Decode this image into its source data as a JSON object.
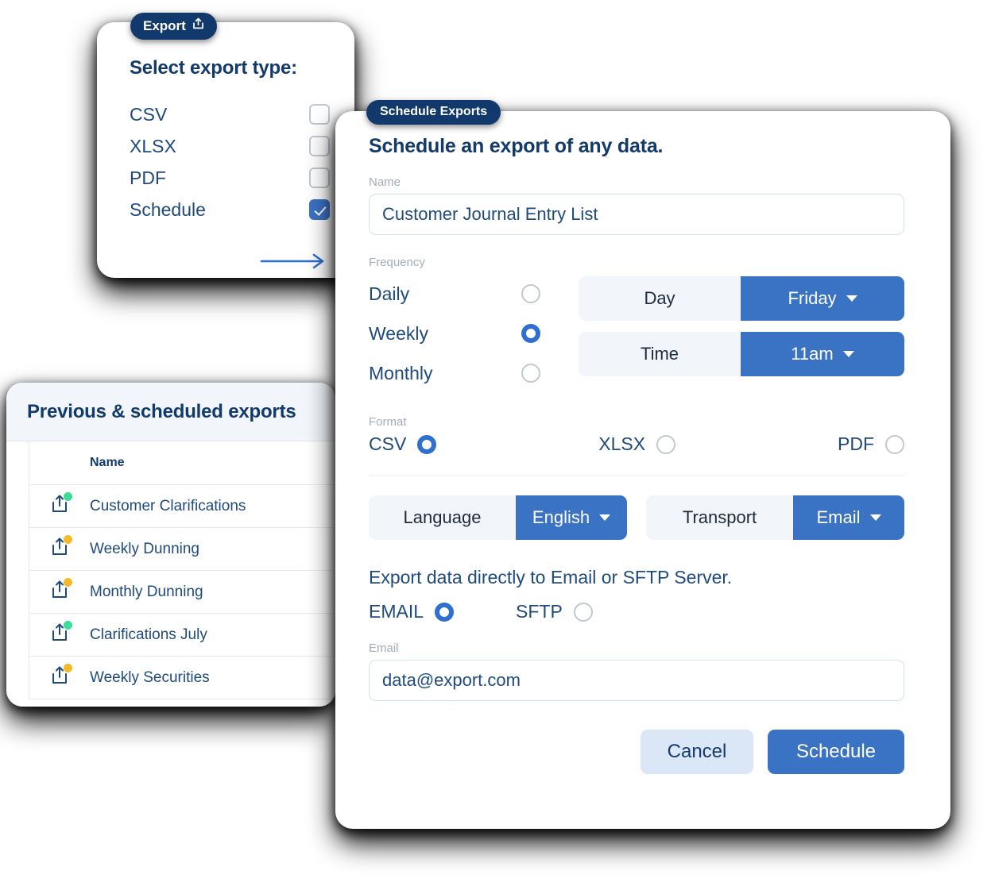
{
  "export_card": {
    "badge_label": "Export",
    "badge_icon": "share-export-icon",
    "title": "Select export type:",
    "options": [
      {
        "label": "CSV",
        "checked": false
      },
      {
        "label": "XLSX",
        "checked": false
      },
      {
        "label": "PDF",
        "checked": false
      },
      {
        "label": "Schedule",
        "checked": true
      }
    ],
    "next_arrow_icon": "arrow-right-icon"
  },
  "exports_list": {
    "title": "Previous & scheduled exports",
    "columns": [
      "Name"
    ],
    "rows": [
      {
        "name": "Customer Clarifications",
        "status_color": "#3ddc97",
        "icon": "share-export-icon"
      },
      {
        "name": "Weekly Dunning",
        "status_color": "#f5b829",
        "icon": "share-export-icon"
      },
      {
        "name": "Monthly Dunning",
        "status_color": "#f5b829",
        "icon": "share-export-icon"
      },
      {
        "name": "Clarifications July",
        "status_color": "#3ddc97",
        "icon": "share-export-icon"
      },
      {
        "name": "Weekly Securities",
        "status_color": "#f5b829",
        "icon": "share-export-icon"
      }
    ]
  },
  "schedule_card": {
    "badge_label": "Schedule Exports",
    "heading": "Schedule an export of any data.",
    "name_field": {
      "label": "Name",
      "value": "Customer Journal Entry List"
    },
    "frequency": {
      "label": "Frequency",
      "options": [
        {
          "label": "Daily",
          "selected": false
        },
        {
          "label": "Weekly",
          "selected": true
        },
        {
          "label": "Monthly",
          "selected": false
        }
      ]
    },
    "day_selector": {
      "key": "Day",
      "value": "Friday"
    },
    "time_selector": {
      "key": "Time",
      "value": "11am"
    },
    "format": {
      "label": "Format",
      "options": [
        {
          "label": "CSV",
          "selected": true
        },
        {
          "label": "XLSX",
          "selected": false
        },
        {
          "label": "PDF",
          "selected": false
        }
      ]
    },
    "language_selector": {
      "key": "Language",
      "value": "English"
    },
    "transport_selector": {
      "key": "Transport",
      "value": "Email"
    },
    "delivery": {
      "title": "Export data directly to Email or SFTP Server.",
      "options": [
        {
          "label": "EMAIL",
          "selected": true
        },
        {
          "label": "SFTP",
          "selected": false
        }
      ]
    },
    "email_field": {
      "label": "Email",
      "value": "data@export.com"
    },
    "buttons": {
      "cancel": "Cancel",
      "submit": "Schedule"
    }
  },
  "colors": {
    "navy": "#123a6b",
    "blue": "#3b73c4",
    "accent_blue": "#2f6fd0",
    "text_blue": "#1e4a7c",
    "label_gray": "#a3acb9",
    "green_status": "#3ddc97",
    "amber_status": "#f5b829"
  }
}
